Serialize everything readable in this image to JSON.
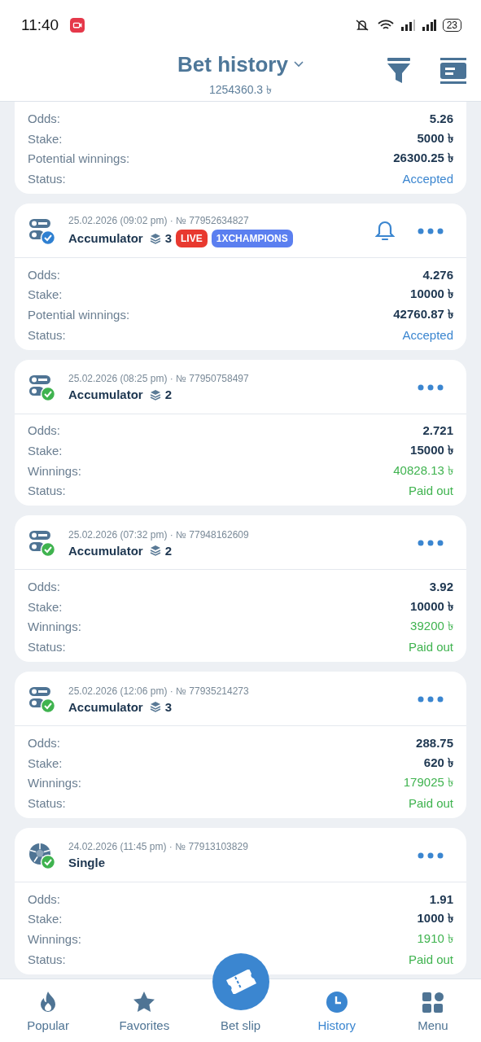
{
  "status_bar": {
    "time": "11:40",
    "battery": "23"
  },
  "header": {
    "title": "Bet history",
    "balance": "1254360.3 ৳"
  },
  "partial_bet": {
    "paid_out": false,
    "rows": [
      {
        "label": "Odds:",
        "value": "5.26",
        "kind": "plain"
      },
      {
        "label": "Stake:",
        "value": "5000 ৳",
        "kind": "plain"
      },
      {
        "label": "Potential winnings:",
        "value": "26300.25 ৳",
        "kind": "win"
      },
      {
        "label": "Status:",
        "value": "Accepted",
        "kind": "status"
      }
    ]
  },
  "bets": [
    {
      "kind": "accumulator",
      "paid_out": false,
      "meta": "25.02.2026 (09:02 pm) · № 77952634827",
      "type": "Accumulator",
      "events": "3",
      "bell": true,
      "tags": [
        {
          "text": "LIVE",
          "color": "#e8392f"
        },
        {
          "text": "1XCHAMPIONS",
          "color": "#5b7ff0"
        }
      ],
      "rows": [
        {
          "label": "Odds:",
          "value": "4.276",
          "kind": "plain"
        },
        {
          "label": "Stake:",
          "value": "10000 ৳",
          "kind": "plain"
        },
        {
          "label": "Potential winnings:",
          "value": "42760.87 ৳",
          "kind": "win"
        },
        {
          "label": "Status:",
          "value": "Accepted",
          "kind": "status"
        }
      ]
    },
    {
      "kind": "accumulator",
      "paid_out": true,
      "meta": "25.02.2026 (08:25 pm) · № 77950758497",
      "type": "Accumulator",
      "events": "2",
      "bell": false,
      "rows": [
        {
          "label": "Odds:",
          "value": "2.721",
          "kind": "plain"
        },
        {
          "label": "Stake:",
          "value": "15000 ৳",
          "kind": "plain"
        },
        {
          "label": "Winnings:",
          "value": "40828.13 ৳",
          "kind": "win"
        },
        {
          "label": "Status:",
          "value": "Paid out",
          "kind": "status"
        }
      ]
    },
    {
      "kind": "accumulator",
      "paid_out": true,
      "meta": "25.02.2026 (07:32 pm) · № 77948162609",
      "type": "Accumulator",
      "events": "2",
      "bell": false,
      "rows": [
        {
          "label": "Odds:",
          "value": "3.92",
          "kind": "plain"
        },
        {
          "label": "Stake:",
          "value": "10000 ৳",
          "kind": "plain"
        },
        {
          "label": "Winnings:",
          "value": "39200 ৳",
          "kind": "win"
        },
        {
          "label": "Status:",
          "value": "Paid out",
          "kind": "status"
        }
      ]
    },
    {
      "kind": "accumulator",
      "paid_out": true,
      "meta": "25.02.2026 (12:06 pm) · № 77935214273",
      "type": "Accumulator",
      "events": "3",
      "bell": false,
      "rows": [
        {
          "label": "Odds:",
          "value": "288.75",
          "kind": "plain"
        },
        {
          "label": "Stake:",
          "value": "620 ৳",
          "kind": "plain"
        },
        {
          "label": "Winnings:",
          "value": "179025 ৳",
          "kind": "win"
        },
        {
          "label": "Status:",
          "value": "Paid out",
          "kind": "status"
        }
      ]
    },
    {
      "kind": "single",
      "paid_out": true,
      "meta": "24.02.2026 (11:45 pm) · № 77913103829",
      "type": "Single",
      "bell": false,
      "rows": [
        {
          "label": "Odds:",
          "value": "1.91",
          "kind": "plain"
        },
        {
          "label": "Stake:",
          "value": "1000 ৳",
          "kind": "plain"
        },
        {
          "label": "Winnings:",
          "value": "1910 ৳",
          "kind": "win"
        },
        {
          "label": "Status:",
          "value": "Paid out",
          "kind": "status"
        }
      ]
    }
  ],
  "nav": [
    {
      "label": "Popular",
      "kind": "popular",
      "selected": false
    },
    {
      "label": "Favorites",
      "kind": "favorites",
      "selected": false
    },
    {
      "label": "Bet slip",
      "kind": "slip",
      "selected": false
    },
    {
      "label": "History",
      "kind": "history",
      "selected": true
    },
    {
      "label": "Menu",
      "kind": "menu",
      "selected": false
    }
  ]
}
